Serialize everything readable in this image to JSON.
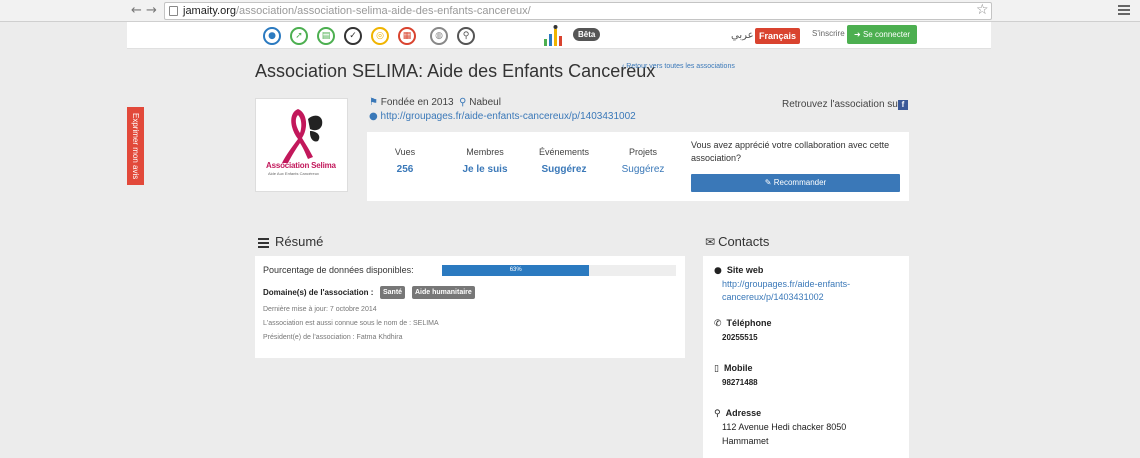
{
  "browser": {
    "url_host": "jamaity.org",
    "url_path": "/association/association-selima-aide-des-enfants-cancereux/"
  },
  "header": {
    "nav_icons": [
      "community-icon",
      "rocket-icon",
      "news-icon",
      "thumbs-icon",
      "target-icon",
      "calendar-icon",
      "globe-icon",
      "search-icon"
    ],
    "beta": "Bêta",
    "arabic": "عربي",
    "french": "Français",
    "signup": "S'inscrire",
    "login": "Se connecter"
  },
  "feedback_tab": "Exprimer mon avis",
  "page": {
    "title": "Association SELIMA: Aide des Enfants Cancereux",
    "back_link": "Retour vers toutes les associations"
  },
  "logo": {
    "line1": "Association Selima",
    "line2": "Aide Aux Enfants Cancéreux"
  },
  "meta": {
    "founded": "Fondée en 2013",
    "city": "Nabeul",
    "website": "http://groupages.fr/aide-enfants-cancereux/p/1403431002",
    "find_on": "Retrouvez l'association sur"
  },
  "stats": [
    {
      "label": "Vues",
      "value": "256"
    },
    {
      "label": "Membres",
      "value": "Je le suis"
    },
    {
      "label": "Événements",
      "value": "Suggérez"
    },
    {
      "label": "Projets",
      "value": "Suggérez"
    }
  ],
  "appreciate_text": "Vous avez apprécié votre collaboration avec cette association?",
  "recommend_btn": "Recommander",
  "resume": {
    "heading": "Résumé",
    "pct_label": "Pourcentage de données disponibles:",
    "pct": 63,
    "pct_text": "63%",
    "domain_label": "Domaine(s) de l'association :",
    "tags": [
      "Santé",
      "Aide humanitaire"
    ],
    "updated": "Dernière mise à jour: 7 octobre 2014",
    "known_as": "L'association est aussi connue sous le nom de : SELIMA",
    "president": "Président(e) de l'association : Fatma Khdhira"
  },
  "contacts": {
    "heading": "Contacts",
    "website_label": "Site web",
    "website_line1": "http://groupages.fr/aide-enfants-",
    "website_line2": "cancereux/p/1403431002",
    "phone_label": "Téléphone",
    "phone": "20255515",
    "mobile_label": "Mobile",
    "mobile": "98271488",
    "address_label": "Adresse",
    "address_line1": "112 Avenue Hedi chacker 8050",
    "address_line2": "Hammamet"
  },
  "colors": {
    "accent": "#3a78b8",
    "red": "#d9432f",
    "green": "#4caf50",
    "progress": "#2b7ac0"
  }
}
